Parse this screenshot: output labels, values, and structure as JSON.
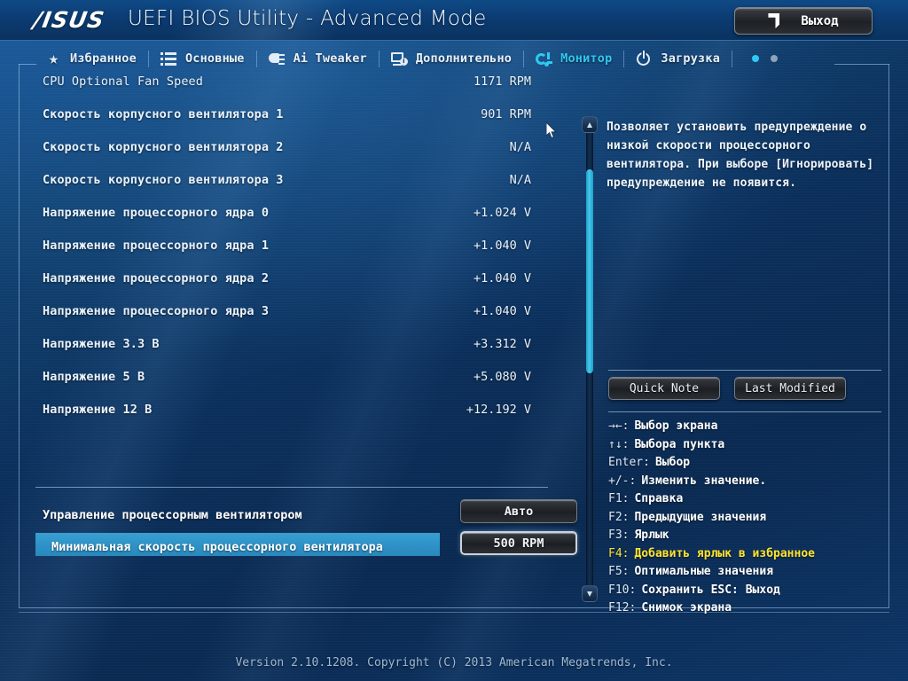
{
  "titlebar": {
    "logo": "/ISUS",
    "title": "UEFI BIOS Utility - Advanced Mode",
    "exit_label": "Выход",
    "exit_icon": "door-exit-icon"
  },
  "tabs": [
    {
      "label": "Избранное",
      "icon": "star-icon",
      "active": false
    },
    {
      "label": "Основные",
      "icon": "list-icon",
      "active": false
    },
    {
      "label": "Ai Tweaker",
      "icon": "tweaker-icon",
      "active": false
    },
    {
      "label": "Дополнительно",
      "icon": "advanced-icon",
      "active": false
    },
    {
      "label": "Монитор",
      "icon": "monitor-fan-icon",
      "active": true
    },
    {
      "label": "Загрузка",
      "icon": "power-icon",
      "active": false
    }
  ],
  "page_dots": [
    true,
    false
  ],
  "monitor_rows": [
    {
      "name": "CPU Optional Fan Speed",
      "value": "1171 RPM",
      "bold": false
    },
    {
      "name": "Скорость корпусного вентилятора 1",
      "value": "901 RPM",
      "bold": true
    },
    {
      "name": "Скорость корпусного вентилятора 2",
      "value": "N/A",
      "bold": true
    },
    {
      "name": "Скорость корпусного вентилятора 3",
      "value": "N/A",
      "bold": true
    },
    {
      "name": "Напряжение процессорного ядра 0",
      "value": "+1.024 V",
      "bold": true
    },
    {
      "name": "Напряжение процессорного ядра 1",
      "value": "+1.040 V",
      "bold": true
    },
    {
      "name": "Напряжение процессорного ядра 2",
      "value": "+1.040 V",
      "bold": true
    },
    {
      "name": "Напряжение процессорного ядра 3",
      "value": "+1.040 V",
      "bold": true
    },
    {
      "name": "Напряжение 3.3 В",
      "value": "+3.312 V",
      "bold": true
    },
    {
      "name": "Напряжение 5 В",
      "value": "+5.080 V",
      "bold": true
    },
    {
      "name": "Напряжение 12 В",
      "value": "+12.192 V",
      "bold": true
    }
  ],
  "controls": [
    {
      "label": "Управление процессорным вентилятором",
      "value": "Авто",
      "selected": false
    },
    {
      "label": "Минимальная скорость процессорного вентилятора",
      "value": "500 RPM",
      "selected": true
    }
  ],
  "help": {
    "text": "Позволяет установить предупреждение о низкой скорости процессорного вентилятора. При выборе [Игнорировать] предупреждение не появится.",
    "quick_note_label": "Quick Note",
    "last_modified_label": "Last Modified"
  },
  "shortcuts": [
    {
      "key": "→←:",
      "desc": "Выбор экрана",
      "highlight": false
    },
    {
      "key": "↑↓:",
      "desc": "Выбора пункта",
      "highlight": false
    },
    {
      "key": "Enter:",
      "desc": "Выбор",
      "highlight": false
    },
    {
      "key": "+/-:",
      "desc": "Изменить значение.",
      "highlight": false
    },
    {
      "key": "F1:",
      "desc": "Справка",
      "highlight": false
    },
    {
      "key": "F2:",
      "desc": "Предыдущие значения",
      "highlight": false
    },
    {
      "key": "F3:",
      "desc": "Ярлык",
      "highlight": false
    },
    {
      "key": "F4:",
      "desc": "Добавить ярлык в избранное",
      "highlight": true
    },
    {
      "key": "F5:",
      "desc": "Оптимальные значения",
      "highlight": false
    },
    {
      "key": "F10:",
      "desc": "Сохранить ESC: Выход",
      "highlight": false
    },
    {
      "key": "F12:",
      "desc": "Снимок экрана",
      "highlight": false
    }
  ],
  "footer": {
    "version": "Version 2.10.1208. Copyright (C) 2013 American Megatrends, Inc."
  },
  "colors": {
    "accent_cyan": "#2fc8f2",
    "highlight_row": "#2e93c8",
    "shortcut_highlight": "#ffe32e",
    "scrollbar_thumb": "#45c8ec"
  }
}
